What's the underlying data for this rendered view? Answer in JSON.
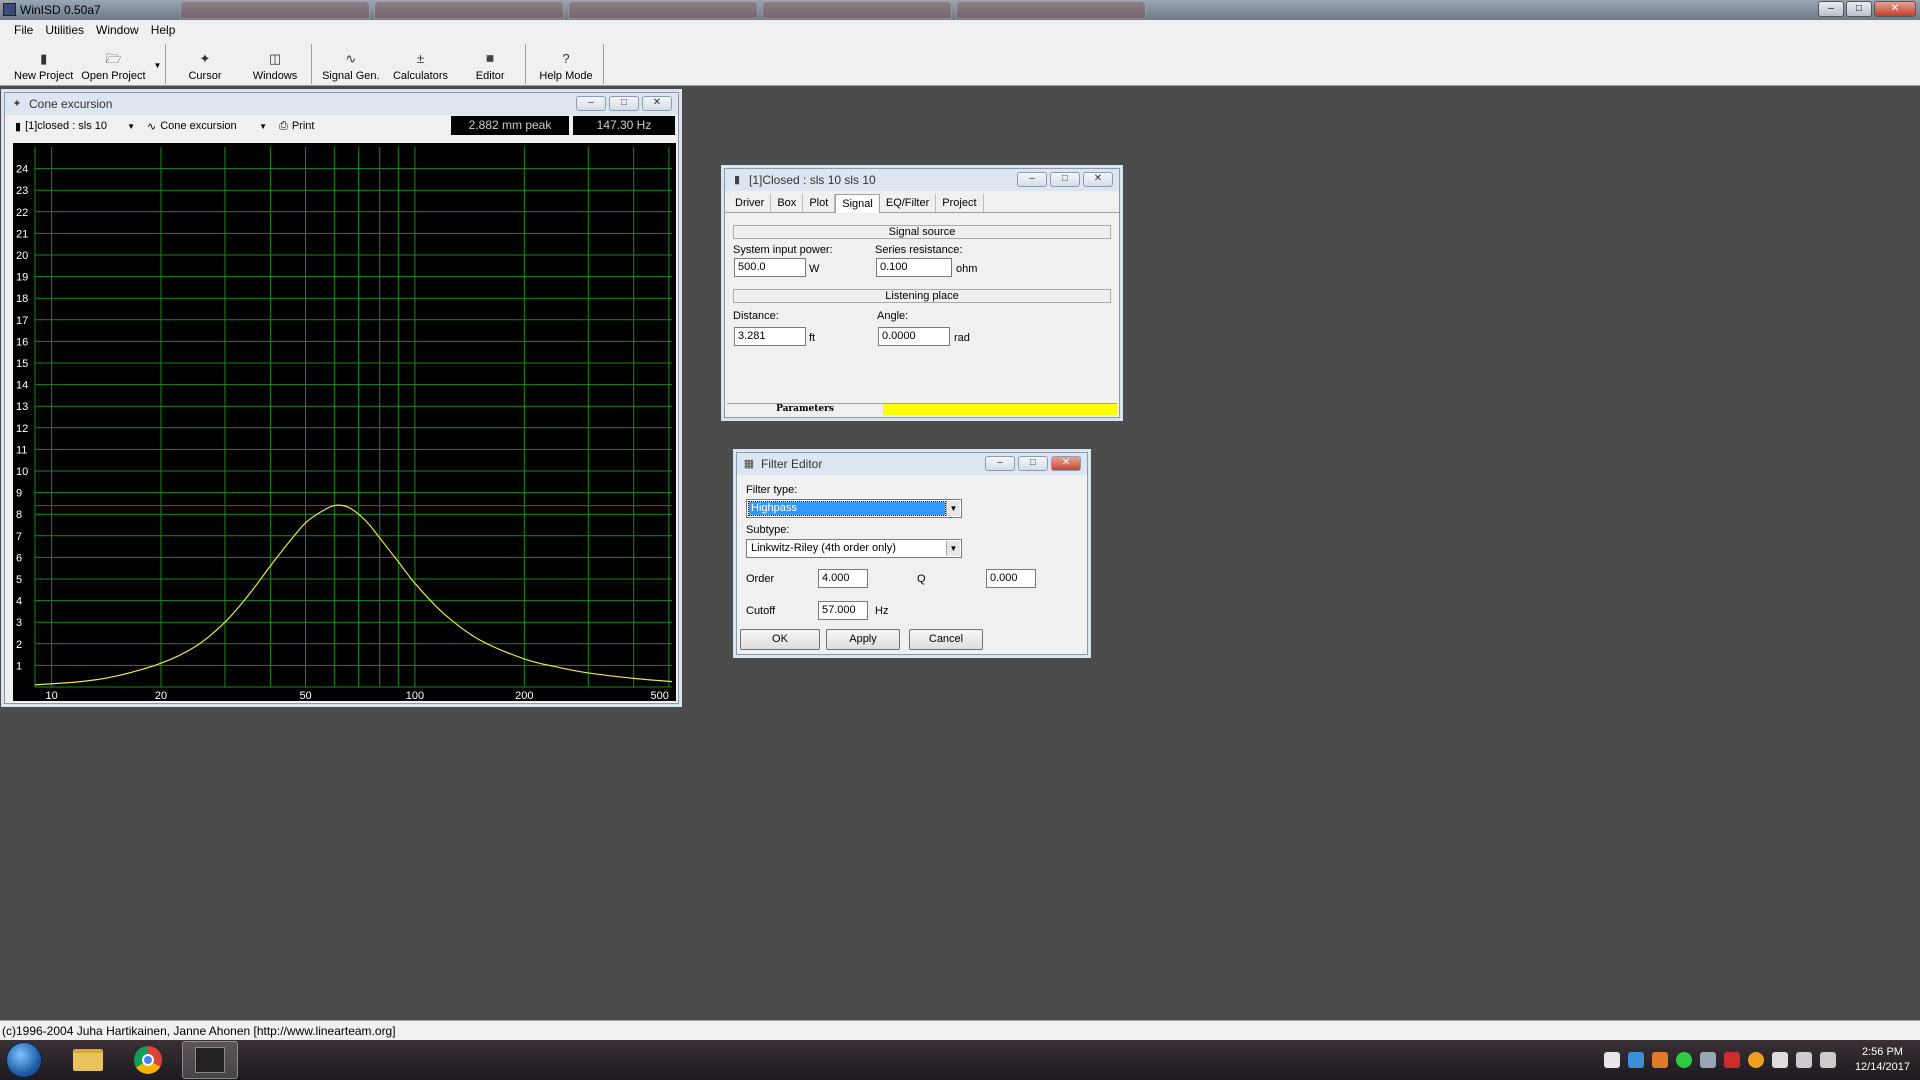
{
  "app": {
    "title": "WinISD 0.50a7"
  },
  "menu": [
    "File",
    "Utilities",
    "Window",
    "Help"
  ],
  "toolbar": {
    "new_project": "New Project",
    "open_project": "Open Project",
    "cursor": "Cursor",
    "windows": "Windows",
    "signal_gen": "Signal Gen.",
    "calculators": "Calculators",
    "editor": "Editor",
    "help_mode": "Help Mode"
  },
  "cone_window": {
    "title": "Cone excursion",
    "project_select": "[1]closed : sls 10",
    "graph_select": "Cone excursion",
    "print": "Print",
    "peak_readout": "2.882 mm peak",
    "freq_readout": "147.30 Hz"
  },
  "chart_data": {
    "type": "line",
    "title": "Cone excursion",
    "xlabel": "",
    "ylabel": "",
    "x_scale": "log",
    "xlim": [
      9,
      510
    ],
    "ylim": [
      0,
      25
    ],
    "x_ticks": [
      10,
      20,
      50,
      100,
      200,
      500
    ],
    "y_ticks": [
      1,
      2,
      3,
      4,
      5,
      6,
      7,
      8,
      9,
      10,
      11,
      12,
      13,
      14,
      15,
      16,
      17,
      18,
      19,
      20,
      21,
      22,
      23,
      24
    ],
    "grid": true,
    "reference_line_y": 8.4,
    "series": [
      {
        "color": "#e8e84a",
        "x": [
          9,
          12,
          15,
          20,
          25,
          30,
          35,
          40,
          45,
          50,
          55,
          60,
          65,
          70,
          75,
          80,
          90,
          100,
          120,
          150,
          200,
          250,
          300,
          400,
          510
        ],
        "y": [
          0.1,
          0.25,
          0.5,
          1.1,
          1.9,
          3.0,
          4.3,
          5.6,
          6.7,
          7.6,
          8.1,
          8.4,
          8.35,
          8.0,
          7.5,
          6.9,
          5.8,
          4.8,
          3.4,
          2.2,
          1.3,
          0.9,
          0.65,
          0.4,
          0.25
        ]
      }
    ]
  },
  "props_window": {
    "title": "[1]Closed : sls 10 sls 10",
    "tabs": [
      "Driver",
      "Box",
      "Plot",
      "Signal",
      "EQ/Filter",
      "Project"
    ],
    "active_tab": "Signal",
    "signal_source": "Signal source",
    "system_input_power_label": "System input power:",
    "system_input_power": "500.0",
    "power_unit": "W",
    "series_resistance_label": "Series resistance:",
    "series_resistance": "0.100",
    "resistance_unit": "ohm",
    "listening_place": "Listening place",
    "distance_label": "Distance:",
    "distance": "3.281",
    "distance_unit": "ft",
    "angle_label": "Angle:",
    "angle": "0.0000",
    "angle_unit": "rad",
    "status_panel": "Parameters"
  },
  "filter_editor": {
    "title": "Filter Editor",
    "filter_type_label": "Filter type:",
    "filter_type": "Highpass",
    "subtype_label": "Subtype:",
    "subtype": "Linkwitz-Riley (4th order only)",
    "order_label": "Order",
    "order": "4.000",
    "q_label": "Q",
    "q": "0.000",
    "cutoff_label": "Cutoff",
    "cutoff": "57.000",
    "cutoff_unit": "Hz",
    "ok": "OK",
    "apply": "Apply",
    "cancel": "Cancel"
  },
  "status_line": "(c)1996-2004 Juha Hartikainen, Janne Ahonen [http://www.linearteam.org]",
  "taskbar": {
    "time": "2:56 PM",
    "date": "12/14/2017"
  },
  "colors": {
    "chart_bg": "#000000",
    "grid": "#1a8a1a",
    "curve": "#e8e84a",
    "ref_line": "#d01010",
    "status_yellow": "#ffff00"
  }
}
